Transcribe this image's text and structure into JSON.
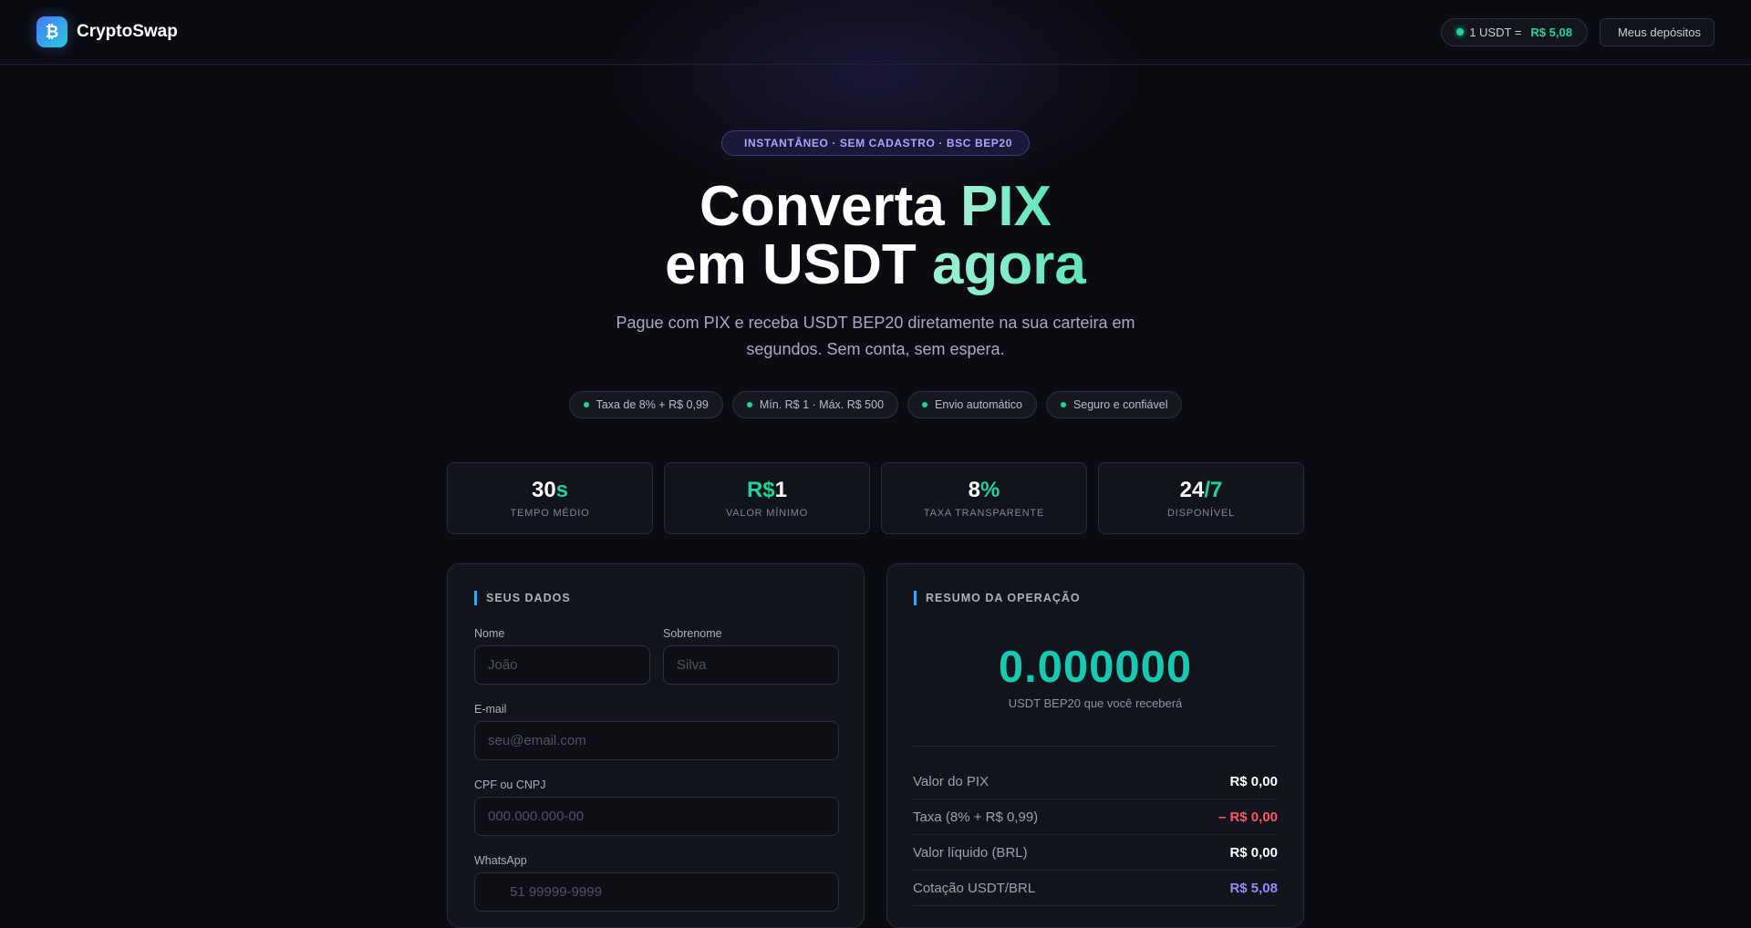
{
  "header": {
    "brand_logo": "₿",
    "brand_name": "CryptoSwap",
    "rate_prefix": "1 USDT =",
    "rate_value": "R$ 5,08",
    "deposits_icon": "",
    "deposits_label": "Meus depósitos"
  },
  "hero": {
    "badge_icon": "",
    "badge_text": "INSTANTÂNEO · SEM CADASTRO · BSC BEP20",
    "title_part1": "Converta ",
    "title_part2": "PIX",
    "title_part3": "em USDT ",
    "title_part4": "agora",
    "subtitle": "Pague com PIX e receba USDT BEP20 diretamente na sua carteira em segundos. Sem conta, sem espera.",
    "features": [
      "Taxa de 8% + R$ 0,99",
      "Mín. R$ 1 · Máx. R$ 500",
      "Envio automático",
      "Seguro e confiável"
    ]
  },
  "stats": [
    {
      "value_a": "30",
      "value_b": "s",
      "label": "TEMPO MÉDIO"
    },
    {
      "value_a": "R$",
      "value_b": "1",
      "label": "VALOR MÍNIMO"
    },
    {
      "value_a": "8",
      "value_b": "%",
      "label": "TAXA TRANSPARENTE"
    },
    {
      "value_a": "24",
      "value_b": "/7",
      "label": "DISPONÍVEL"
    }
  ],
  "form": {
    "title": "SEUS DADOS",
    "first_name_label": "Nome",
    "first_name_placeholder": "João",
    "last_name_label": "Sobrenome",
    "last_name_placeholder": "Silva",
    "email_label": "E-mail",
    "email_placeholder": "seu@email.com",
    "cpf_label": "CPF ou CNPJ",
    "cpf_placeholder": "000.000.000-00",
    "whatsapp_label": "WhatsApp",
    "whatsapp_icon": "",
    "whatsapp_placeholder": "51 99999-9999"
  },
  "summary": {
    "title": "RESUMO DA OPERAÇÃO",
    "amount": "0.000000",
    "amount_caption": "USDT BEP20 que você receberá",
    "rows": [
      {
        "label": "Valor do PIX",
        "value": "R$ 0,00"
      },
      {
        "label": "Taxa (8% + R$ 0,99)",
        "value": "– R$ 0,00"
      },
      {
        "label": "Valor líquido (BRL)",
        "value": "R$ 0,00"
      },
      {
        "label": "Cotação USDT/BRL",
        "value": "R$ 5,08"
      }
    ]
  },
  "colors": {
    "accent_green": "#1fd39a",
    "accent_teal": "#17c9b1",
    "accent_purple": "#8f8cff",
    "negative_red": "#ff5566",
    "background": "#0b0c12"
  }
}
